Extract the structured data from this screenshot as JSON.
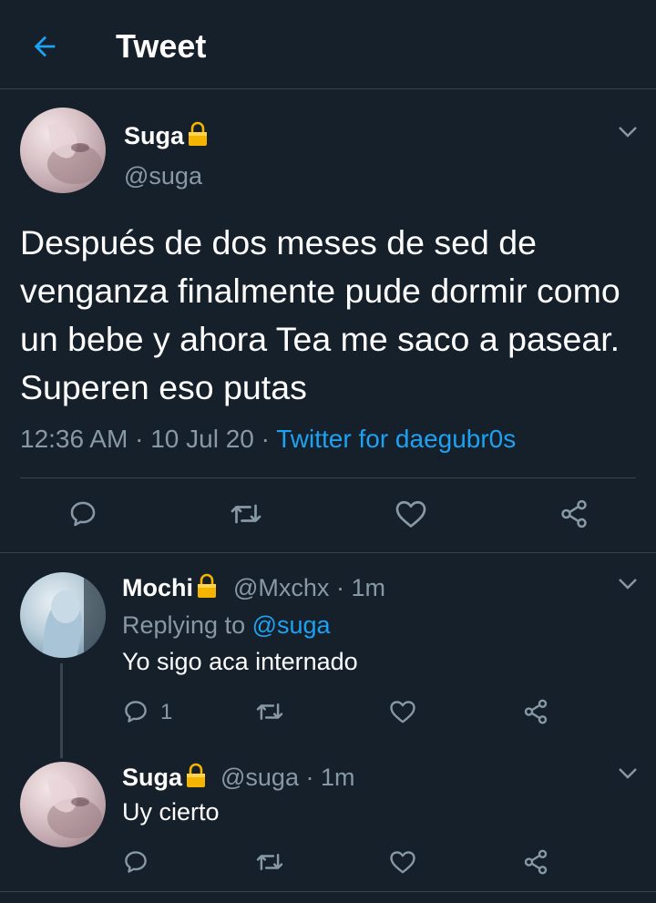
{
  "header": {
    "title": "Tweet"
  },
  "main_tweet": {
    "name": "Suga",
    "handle": "@suga",
    "text": "Después de dos meses de sed de venganza finalmente pude dormir como un bebe y ahora Tea me saco a pasear. Superen eso putas",
    "time": "12:36 AM",
    "date": "10 Jul 20",
    "source": "Twitter for daegubr0s",
    "dot": "·"
  },
  "reply1": {
    "name": "Mochi",
    "handle": "@Mxchx",
    "time": "1m",
    "replying_prefix": "Replying to",
    "replying_to": "@suga",
    "text": "Yo sigo aca internado",
    "reply_count": "1"
  },
  "reply2": {
    "name": "Suga",
    "handle": "@suga",
    "time": "1m",
    "text": "Uy cierto"
  },
  "colors": {
    "background": "#15202b",
    "accent": "#1da1f2",
    "muted": "#8899a6",
    "divider": "#38444d"
  },
  "icons": [
    "back-arrow-icon",
    "lock-icon",
    "chevron-down-icon",
    "reply-icon",
    "retweet-icon",
    "like-icon",
    "share-icon"
  ]
}
